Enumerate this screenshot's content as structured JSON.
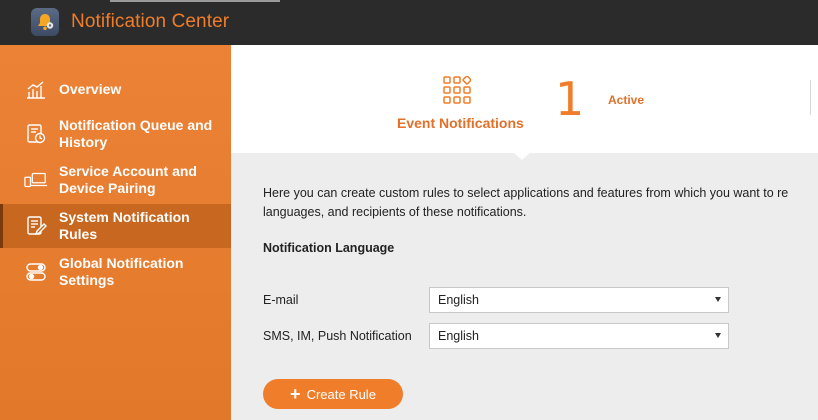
{
  "app": {
    "title": "Notification Center",
    "icon": "bell-gear-icon",
    "accent": "#f07d2a"
  },
  "sidebar": {
    "items": [
      {
        "label": "Overview",
        "icon": "chart-icon",
        "active": false
      },
      {
        "label": "Notification Queue and History",
        "icon": "history-icon",
        "active": false
      },
      {
        "label": "Service Account and Device Pairing",
        "icon": "devices-icon",
        "active": false
      },
      {
        "label": "System Notification Rules",
        "icon": "rules-icon",
        "active": true
      },
      {
        "label": "Global Notification Settings",
        "icon": "toggles-icon",
        "active": false
      }
    ]
  },
  "header": {
    "tab_label": "Event Notifications",
    "tab_icon": "grid-icon",
    "count": "1",
    "count_label": "Active"
  },
  "main": {
    "description_line1": "Here you can create custom rules to select applications and features from which you want to re",
    "description_line2": "languages, and recipients of these notifications.",
    "section_title": "Notification Language",
    "fields": [
      {
        "label": "E-mail",
        "value": "English"
      },
      {
        "label": "SMS, IM, Push Notification",
        "value": "English"
      }
    ],
    "create_rule_label": "Create Rule"
  }
}
